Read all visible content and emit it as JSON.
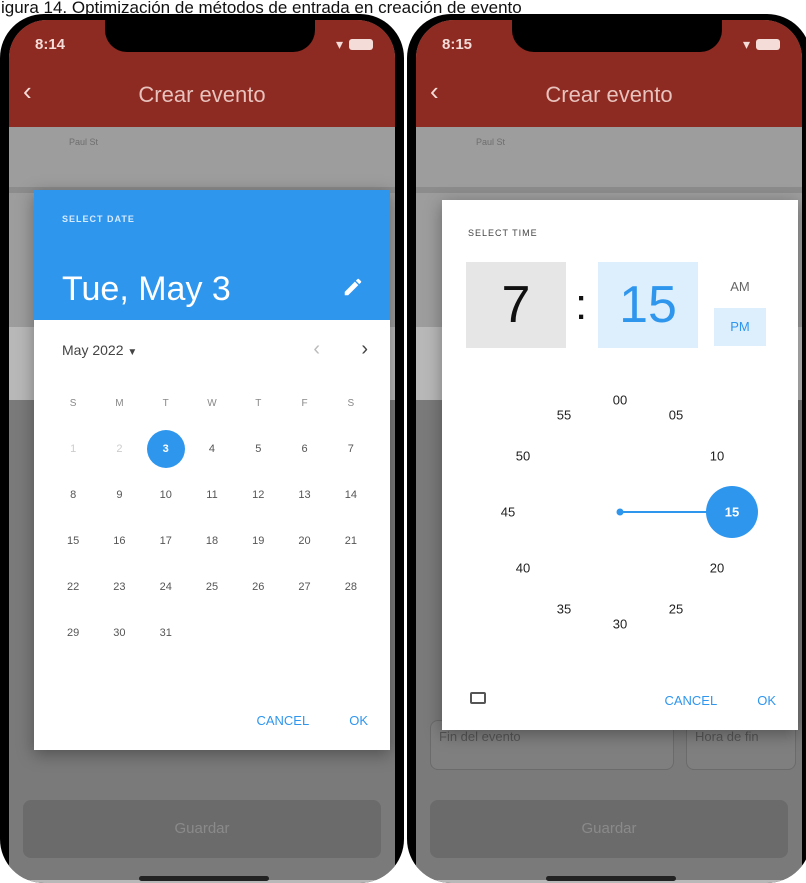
{
  "caption": "igura 14. Optimización de métodos de entrada en creación de evento",
  "left": {
    "status_time": "8:14",
    "title": "Crear evento",
    "street": "Paul St",
    "select_label": "SELECT DATE",
    "big_date": "Tue, May 3",
    "month": "May 2022",
    "weekdays": [
      "S",
      "M",
      "T",
      "W",
      "T",
      "F",
      "S"
    ],
    "weeks": [
      [
        "1",
        "2",
        "3",
        "4",
        "5",
        "6",
        "7"
      ],
      [
        "8",
        "9",
        "10",
        "11",
        "12",
        "13",
        "14"
      ],
      [
        "15",
        "16",
        "17",
        "18",
        "19",
        "20",
        "21"
      ],
      [
        "22",
        "23",
        "24",
        "25",
        "26",
        "27",
        "28"
      ],
      [
        "29",
        "30",
        "31",
        "",
        "",
        "",
        ""
      ]
    ],
    "cancel": "CANCEL",
    "ok": "OK",
    "save": "Guardar"
  },
  "right": {
    "status_time": "8:15",
    "title": "Crear evento",
    "street": "Paul St",
    "select_label": "SELECT TIME",
    "hour": "7",
    "colon": ":",
    "minute": "15",
    "am": "AM",
    "pm": "PM",
    "clock_numbers": [
      "00",
      "05",
      "10",
      "15",
      "20",
      "25",
      "30",
      "35",
      "40",
      "45",
      "50",
      "55"
    ],
    "cancel": "CANCEL",
    "ok": "OK",
    "field_end_event": "Fin del evento",
    "field_end_time": "Hora de fin",
    "save": "Guardar"
  },
  "colors": {
    "appbar": "#8d2a21",
    "accent": "#2f96ee"
  }
}
